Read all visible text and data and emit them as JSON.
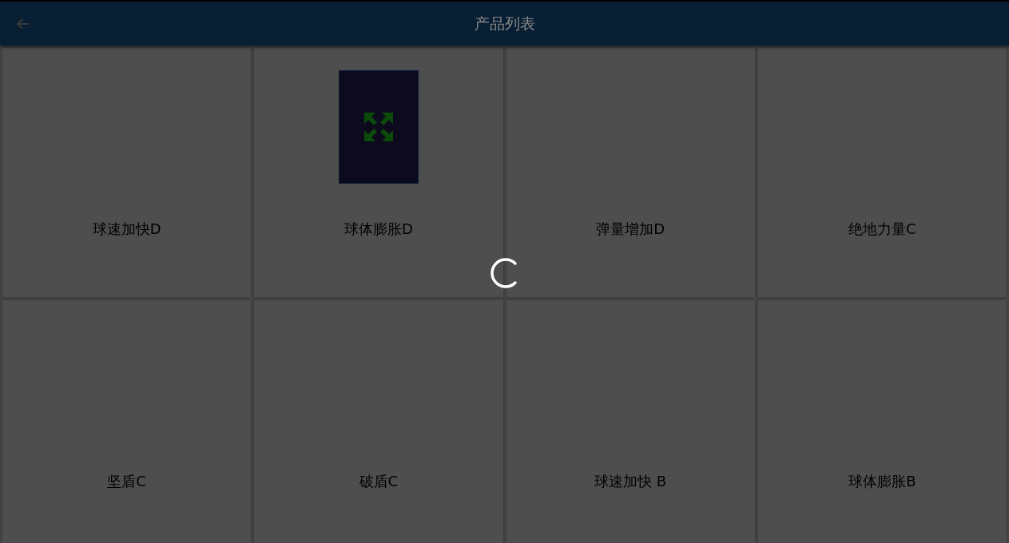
{
  "header": {
    "title": "产品列表"
  },
  "products": [
    {
      "name": "球速加快D",
      "image": false
    },
    {
      "name": "球体膨胀D",
      "image": true
    },
    {
      "name": "弹量增加D",
      "image": false
    },
    {
      "name": "绝地力量C",
      "image": false
    },
    {
      "name": "坚盾C",
      "image": false
    },
    {
      "name": "破盾C",
      "image": false
    },
    {
      "name": "球速加快 B",
      "image": false
    },
    {
      "name": "球体膨胀B",
      "image": false
    }
  ],
  "loading": true
}
